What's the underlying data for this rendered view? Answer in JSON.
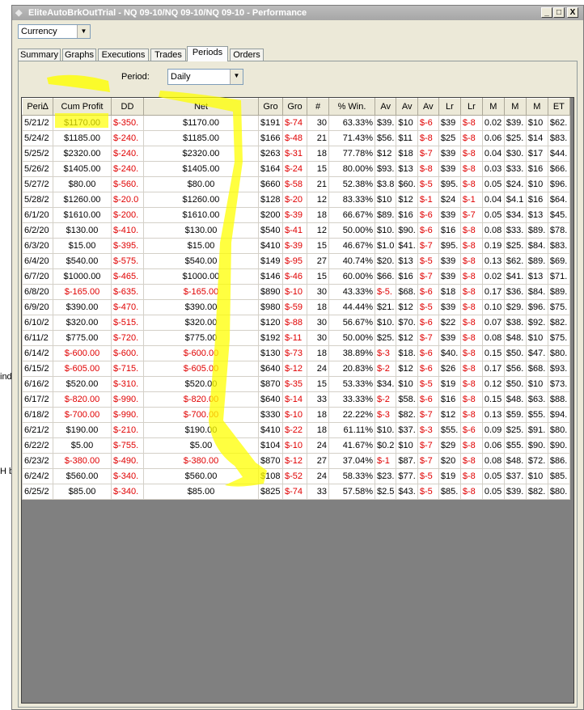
{
  "window": {
    "title": "EliteAutoBrkOutTrial - NQ 09-10/NQ 09-10/NQ 09-10 - Performance",
    "minimize": "_",
    "maximize": "□",
    "close": "X"
  },
  "background_fragments": [
    "ind",
    "H b"
  ],
  "currency_select": {
    "value": "Currency"
  },
  "tabs": [
    {
      "label": "Summary"
    },
    {
      "label": "Graphs"
    },
    {
      "label": "Executions"
    },
    {
      "label": "Trades"
    },
    {
      "label": "Periods"
    },
    {
      "label": "Orders"
    }
  ],
  "active_tab": "Periods",
  "period": {
    "label": "Period:",
    "value": "Daily"
  },
  "grid": {
    "columns": [
      "Peri∆",
      "Cum Profit",
      "DD",
      "Net",
      "Gro",
      "Gro",
      "#",
      "% Win.",
      "Av",
      "Av",
      "Av",
      "Lr",
      "Lr",
      "M",
      "M",
      "M",
      "ET"
    ],
    "rows": [
      [
        "5/21/2",
        "$1170.00",
        "$-350.",
        "$1170.00",
        "$191",
        "$-74",
        "30",
        "63.33%",
        "$39.",
        "$10",
        "$-6",
        "$39",
        "$-8",
        "0.02",
        "$39.",
        "$10",
        "$62."
      ],
      [
        "5/24/2",
        "$1185.00",
        "$-240.",
        "$1185.00",
        "$166",
        "$-48",
        "21",
        "71.43%",
        "$56.",
        "$11",
        "$-8",
        "$25",
        "$-8",
        "0.06",
        "$25.",
        "$14",
        "$83."
      ],
      [
        "5/25/2",
        "$2320.00",
        "$-240.",
        "$2320.00",
        "$263",
        "$-31",
        "18",
        "77.78%",
        "$12",
        "$18",
        "$-7",
        "$39",
        "$-8",
        "0.04",
        "$30.",
        "$17",
        "$44."
      ],
      [
        "5/26/2",
        "$1405.00",
        "$-240.",
        "$1405.00",
        "$164",
        "$-24",
        "15",
        "80.00%",
        "$93.",
        "$13",
        "$-8",
        "$39",
        "$-8",
        "0.03",
        "$33.",
        "$16",
        "$66."
      ],
      [
        "5/27/2",
        "$80.00",
        "$-560.",
        "$80.00",
        "$660",
        "$-58",
        "21",
        "52.38%",
        "$3.8",
        "$60.",
        "$-5",
        "$95.",
        "$-8",
        "0.05",
        "$24.",
        "$10",
        "$96."
      ],
      [
        "5/28/2",
        "$1260.00",
        "$-20.0",
        "$1260.00",
        "$128",
        "$-20",
        "12",
        "83.33%",
        "$10",
        "$12",
        "$-1",
        "$24",
        "$-1",
        "0.04",
        "$4.1",
        "$16",
        "$64."
      ],
      [
        "6/1/20",
        "$1610.00",
        "$-200.",
        "$1610.00",
        "$200",
        "$-39",
        "18",
        "66.67%",
        "$89.",
        "$16",
        "$-6",
        "$39",
        "$-7",
        "0.05",
        "$34.",
        "$13",
        "$45."
      ],
      [
        "6/2/20",
        "$130.00",
        "$-410.",
        "$130.00",
        "$540",
        "$-41",
        "12",
        "50.00%",
        "$10.",
        "$90.",
        "$-6",
        "$16",
        "$-8",
        "0.08",
        "$33.",
        "$89.",
        "$78."
      ],
      [
        "6/3/20",
        "$15.00",
        "$-395.",
        "$15.00",
        "$410",
        "$-39",
        "15",
        "46.67%",
        "$1.0",
        "$41.",
        "$-7",
        "$95.",
        "$-8",
        "0.19",
        "$25.",
        "$84.",
        "$83."
      ],
      [
        "6/4/20",
        "$540.00",
        "$-575.",
        "$540.00",
        "$149",
        "$-95",
        "27",
        "40.74%",
        "$20.",
        "$13",
        "$-5",
        "$39",
        "$-8",
        "0.13",
        "$62.",
        "$89.",
        "$69."
      ],
      [
        "6/7/20",
        "$1000.00",
        "$-465.",
        "$1000.00",
        "$146",
        "$-46",
        "15",
        "60.00%",
        "$66.",
        "$16",
        "$-7",
        "$39",
        "$-8",
        "0.02",
        "$41.",
        "$13",
        "$71."
      ],
      [
        "6/8/20",
        "$-165.00",
        "$-635.",
        "$-165.00",
        "$890",
        "$-10",
        "30",
        "43.33%",
        "$-5.",
        "$68.",
        "$-6",
        "$18",
        "$-8",
        "0.17",
        "$36.",
        "$84.",
        "$89."
      ],
      [
        "6/9/20",
        "$390.00",
        "$-470.",
        "$390.00",
        "$980",
        "$-59",
        "18",
        "44.44%",
        "$21.",
        "$12",
        "$-5",
        "$39",
        "$-8",
        "0.10",
        "$29.",
        "$96.",
        "$75."
      ],
      [
        "6/10/2",
        "$320.00",
        "$-515.",
        "$320.00",
        "$120",
        "$-88",
        "30",
        "56.67%",
        "$10.",
        "$70.",
        "$-6",
        "$22",
        "$-8",
        "0.07",
        "$38.",
        "$92.",
        "$82."
      ],
      [
        "6/11/2",
        "$775.00",
        "$-720.",
        "$775.00",
        "$192",
        "$-11",
        "30",
        "50.00%",
        "$25.",
        "$12",
        "$-7",
        "$39",
        "$-8",
        "0.08",
        "$48.",
        "$10",
        "$75."
      ],
      [
        "6/14/2",
        "$-600.00",
        "$-600.",
        "$-600.00",
        "$130",
        "$-73",
        "18",
        "38.89%",
        "$-3",
        "$18.",
        "$-6",
        "$40.",
        "$-8",
        "0.15",
        "$50.",
        "$47.",
        "$80."
      ],
      [
        "6/15/2",
        "$-605.00",
        "$-715.",
        "$-605.00",
        "$640",
        "$-12",
        "24",
        "20.83%",
        "$-2",
        "$12",
        "$-6",
        "$26",
        "$-8",
        "0.17",
        "$56.",
        "$68.",
        "$93."
      ],
      [
        "6/16/2",
        "$520.00",
        "$-310.",
        "$520.00",
        "$870",
        "$-35",
        "15",
        "53.33%",
        "$34.",
        "$10",
        "$-5",
        "$19",
        "$-8",
        "0.12",
        "$50.",
        "$10",
        "$73."
      ],
      [
        "6/17/2",
        "$-820.00",
        "$-990.",
        "$-820.00",
        "$640",
        "$-14",
        "33",
        "33.33%",
        "$-2",
        "$58.",
        "$-6",
        "$16",
        "$-8",
        "0.15",
        "$48.",
        "$63.",
        "$88."
      ],
      [
        "6/18/2",
        "$-700.00",
        "$-990.",
        "$-700.00",
        "$330",
        "$-10",
        "18",
        "22.22%",
        "$-3",
        "$82.",
        "$-7",
        "$12",
        "$-8",
        "0.13",
        "$59.",
        "$55.",
        "$94."
      ],
      [
        "6/21/2",
        "$190.00",
        "$-210.",
        "$190.00",
        "$410",
        "$-22",
        "18",
        "61.11%",
        "$10.",
        "$37.",
        "$-3",
        "$55.",
        "$-6",
        "0.09",
        "$25.",
        "$91.",
        "$80."
      ],
      [
        "6/22/2",
        "$5.00",
        "$-755.",
        "$5.00",
        "$104",
        "$-10",
        "24",
        "41.67%",
        "$0.2",
        "$10",
        "$-7",
        "$29",
        "$-8",
        "0.06",
        "$55.",
        "$90.",
        "$90."
      ],
      [
        "6/23/2",
        "$-380.00",
        "$-490.",
        "$-380.00",
        "$870",
        "$-12",
        "27",
        "37.04%",
        "$-1",
        "$87.",
        "$-7",
        "$20",
        "$-8",
        "0.08",
        "$48.",
        "$72.",
        "$86."
      ],
      [
        "6/24/2",
        "$560.00",
        "$-340.",
        "$560.00",
        "$108",
        "$-52",
        "24",
        "58.33%",
        "$23.",
        "$77.",
        "$-5",
        "$19",
        "$-8",
        "0.05",
        "$37.",
        "$10",
        "$85."
      ],
      [
        "6/25/2",
        "$85.00",
        "$-340.",
        "$85.00",
        "$825",
        "$-74",
        "33",
        "57.58%",
        "$2.5",
        "$43.",
        "$-5",
        "$85.",
        "$-8",
        "0.05",
        "$39.",
        "$82.",
        "$80."
      ]
    ]
  },
  "colors": {
    "negative": "#e00000",
    "highlighter": "#ffff00",
    "grid_background": "#808080"
  }
}
